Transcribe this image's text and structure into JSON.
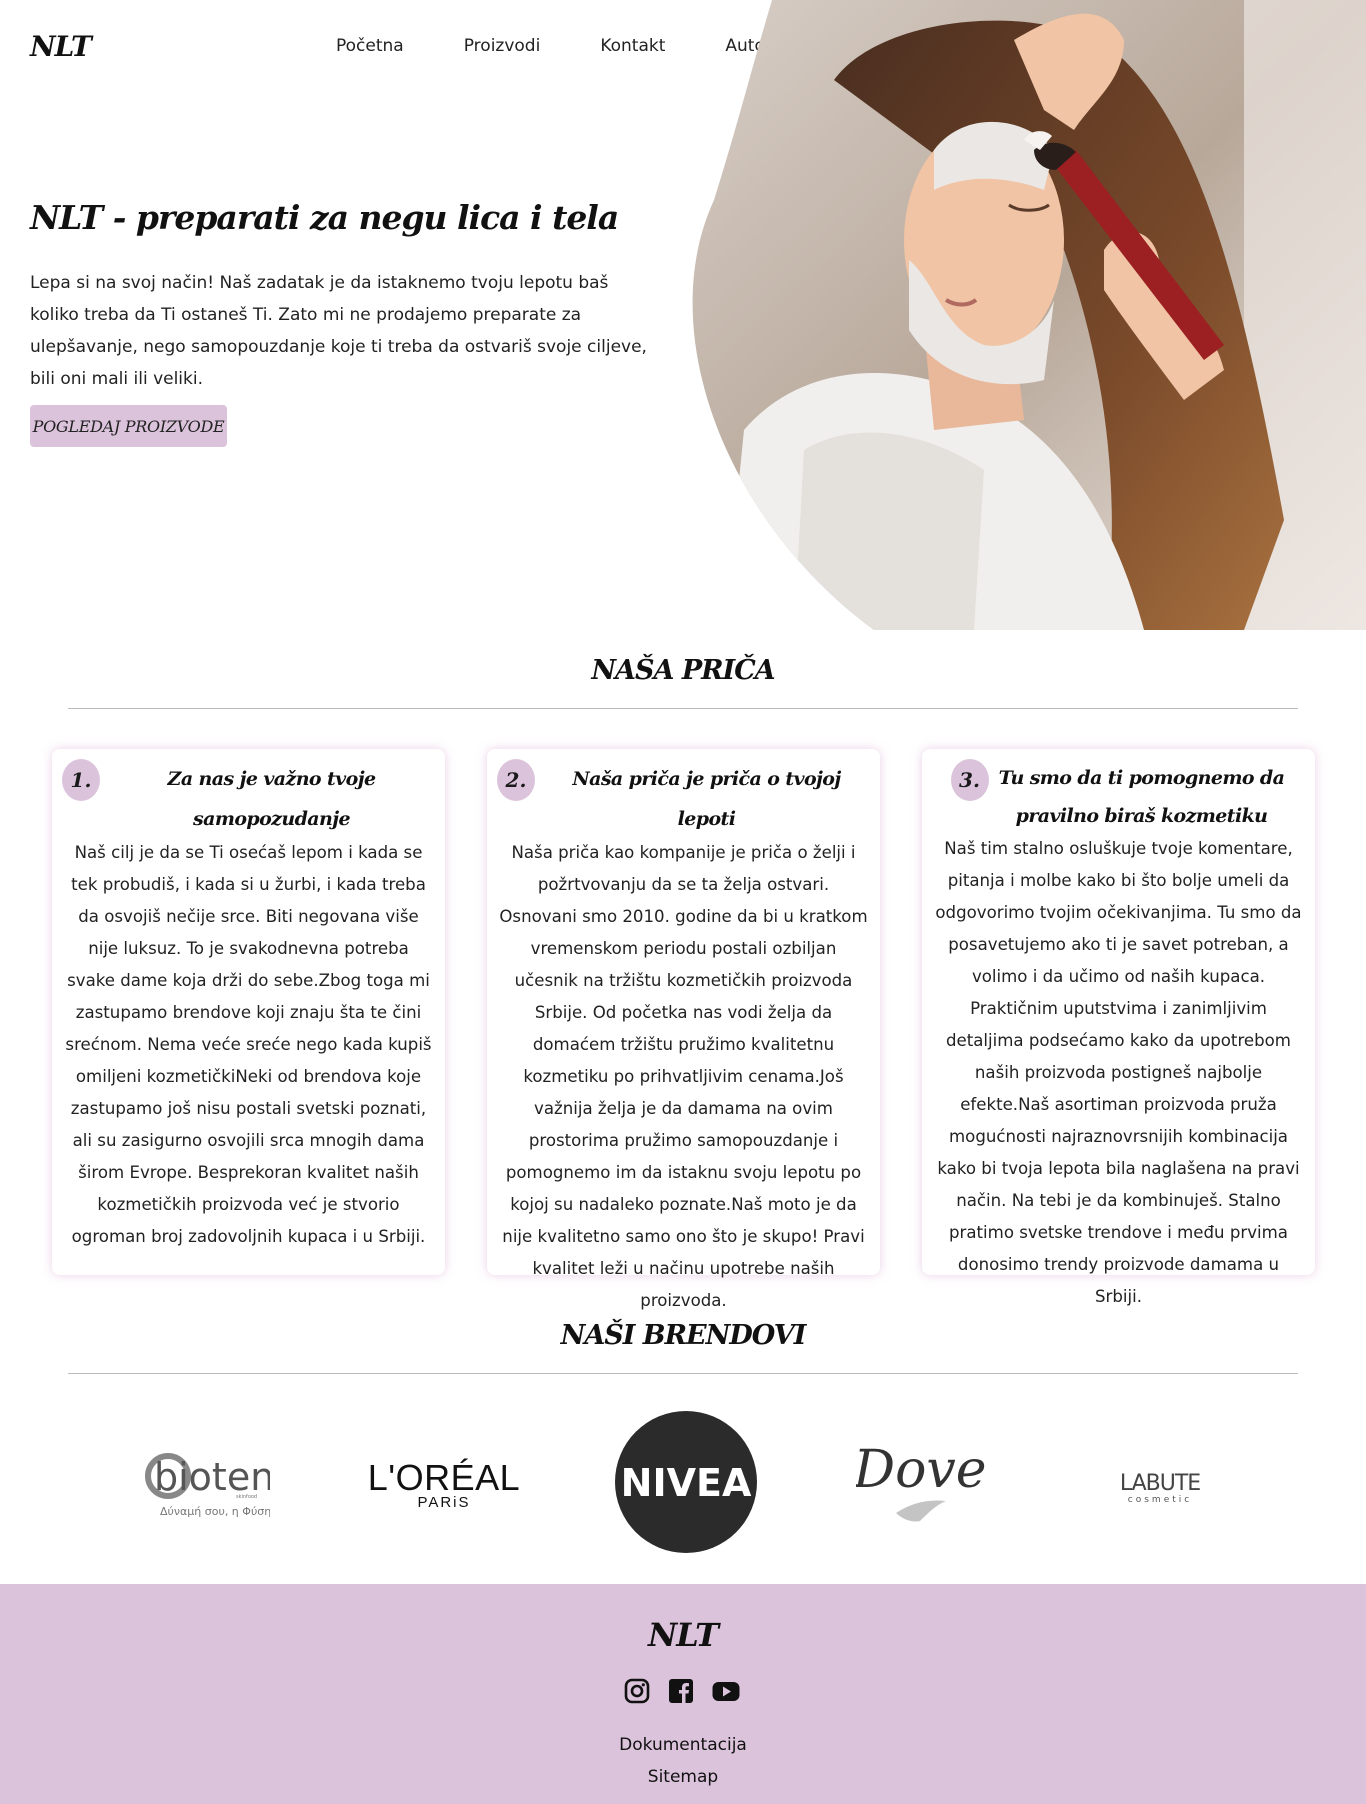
{
  "header": {
    "logo": "NLT",
    "nav": [
      "Početna",
      "Proizvodi",
      "Kontakt",
      "Autor"
    ]
  },
  "hero": {
    "title": "NLT - preparati za negu lica i tela",
    "text": "Lepa si na svoj način! Naš zadatak je da istaknemo tvoju lepotu baš koliko treba da Ti ostaneš Ti. Zato mi ne prodajemo preparate za ulepšavanje, nego samopouzdanje koje ti treba da ostvariš svoje ciljeve, bili oni mali ili veliki.",
    "button": "POGLEDAJ PROIZVODE"
  },
  "story": {
    "heading": "NAŠA PRIČA",
    "cards": [
      {
        "num": "1.",
        "title": "Za nas je važno tvoje samopozudanje",
        "text": "Naš cilj je da se Ti osećaš lepom i kada se tek probudiš, i kada si u žurbi, i kada treba da osvojiš nečije srce. Biti negovana više nije luksuz. To je svakodnevna potreba svake dame koja drži do sebe.Zbog toga mi zastupamo brendove koji znaju šta te čini srećnom. Nema veće sreće nego kada kupiš omiljeni kozmetičkiNeki od brendova koje zastupamo još nisu postali svetski poznati, ali su zasigurno osvojili srca mnogih dama širom Evrope. Besprekoran kvalitet naših kozmetičkih proizvoda već je stvorio ogroman broj zadovoljnih kupaca i u Srbiji."
      },
      {
        "num": "2.",
        "title": "Naša priča je priča o tvojoj lepoti",
        "text": "Naša priča kao kompanije je priča o želji i požrtvovanju da se ta želja ostvari. Osnovani smo 2010. godine da bi u kratkom vremenskom periodu postali ozbiljan učesnik na tržištu kozmetičkih proizvoda Srbije. Od početka nas vodi želja da domaćem tržištu pružimo kvalitetnu kozmetiku po prihvatljivim cenama.Još važnija želja je da damama na ovim prostorima pružimo samopouzdanje i pomognemo im da istaknu svoju lepotu po kojoj su nadaleko poznate.Naš moto je da nije kvalitetno samo ono što je skupo! Pravi kvalitet leži u načinu upotrebe naših proizvoda."
      },
      {
        "num": "3.",
        "title": "Tu smo da ti pomognemo da pravilno biraš kozmetiku",
        "text": "Naš tim stalno osluškuje tvoje komentare, pitanja i molbe kako bi što bolje umeli da odgovorimo tvojim očekivanjima. Tu smo da posavetujemo ako ti je savet potreban, a volimo i da učimo od naših kupaca. Praktičnim uputstvima i zanimljivim detaljima podsećamo kako da upotrebom naših proizvoda postigneš najbolje efekte.Naš asortiman proizvoda pruža mogućnosti najraznovrsnijih kombinacija kako bi tvoja lepota bila naglašena na pravi način. Na tebi je da kombinuješ. Stalno pratimo svetske trendove i među prvima donosimo trendy proizvode damama u Srbiji."
      }
    ]
  },
  "brands": {
    "heading": "NAŠI BRENDOVI",
    "items": [
      {
        "name": "bioten",
        "tagline": "Δύναμή σου, η Φύση",
        "small": "skinfood"
      },
      {
        "name": "L'ORÉAL",
        "sub": "PARiS"
      },
      {
        "name": "NIVEA"
      },
      {
        "name": "Dove"
      },
      {
        "name": "LABUTE",
        "sub": "cosmetic"
      }
    ]
  },
  "footer": {
    "logo": "NLT",
    "socials": [
      "instagram-icon",
      "facebook-icon",
      "youtube-icon"
    ],
    "links": [
      "Dokumentacija",
      "Sitemap"
    ]
  },
  "colors": {
    "accent": "#dcc3dc",
    "text": "#1a1a1a",
    "footer_bg": "#dcc3dc"
  }
}
